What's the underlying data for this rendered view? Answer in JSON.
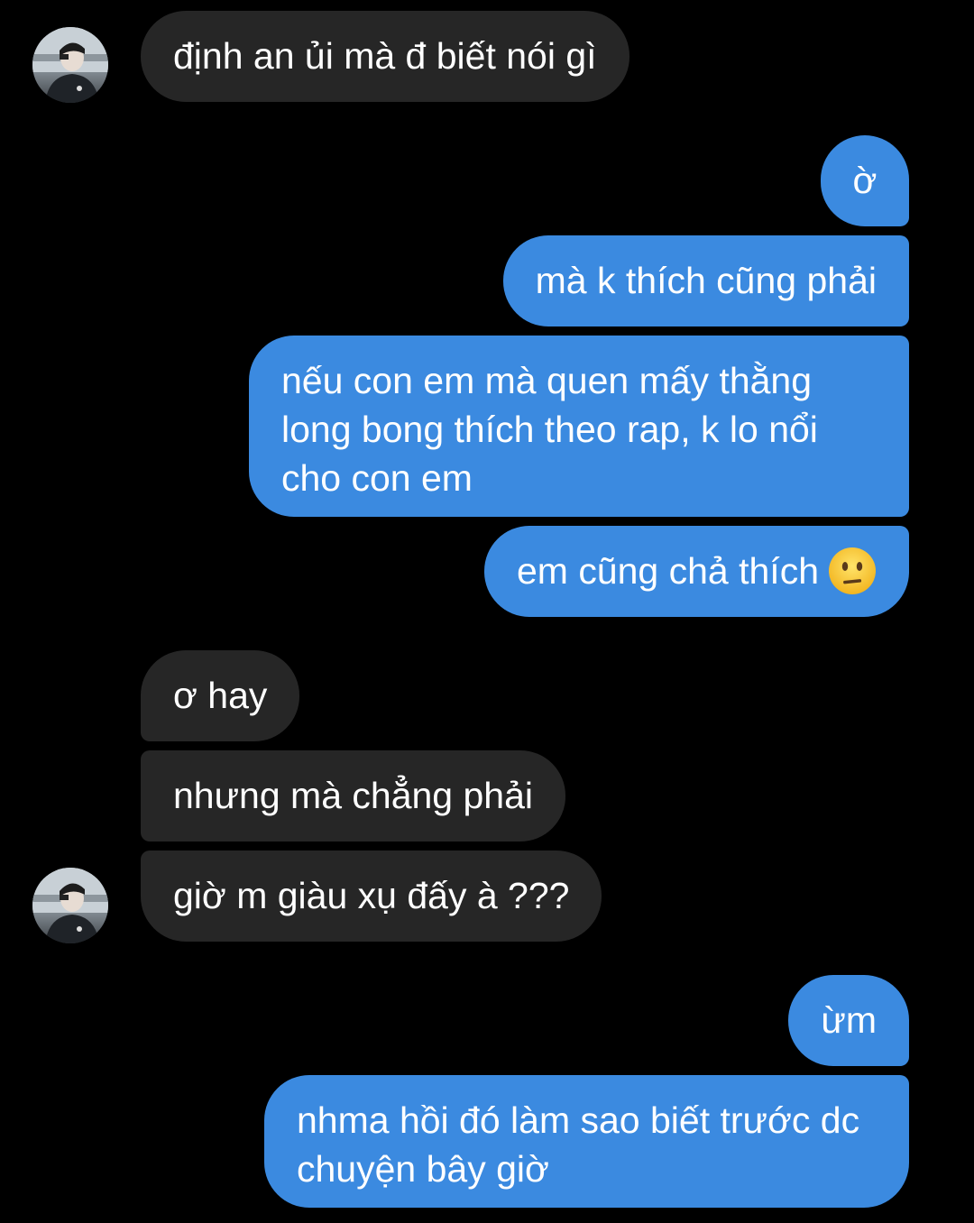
{
  "conversation": {
    "messages": [
      {
        "sender": "them",
        "text": "định an ủi mà đ biết nói gì"
      },
      {
        "sender": "me",
        "text": "ờ"
      },
      {
        "sender": "me",
        "text": "mà k thích cũng phải"
      },
      {
        "sender": "me",
        "text": "nếu con em mà quen mấy thằng long bong thích theo rap, k lo nổi cho con em"
      },
      {
        "sender": "me",
        "text": "em cũng chả thích",
        "emoji": "neutral-face-emoji"
      },
      {
        "sender": "them",
        "text": "ơ hay"
      },
      {
        "sender": "them",
        "text": "nhưng mà chẳng phải"
      },
      {
        "sender": "them",
        "text": "giờ m giàu xụ đấy à ???"
      },
      {
        "sender": "me",
        "text": "ừm"
      },
      {
        "sender": "me",
        "text": "nhma hồi đó làm sao biết trước dc chuyện bây giờ"
      }
    ]
  },
  "colors": {
    "background": "#000000",
    "incoming_bubble": "#262626",
    "outgoing_bubble": "#3b8ae0",
    "text": "#ffffff"
  },
  "icons": {
    "avatar": "contact-avatar-photo",
    "emoji": "neutral-face-emoji"
  }
}
